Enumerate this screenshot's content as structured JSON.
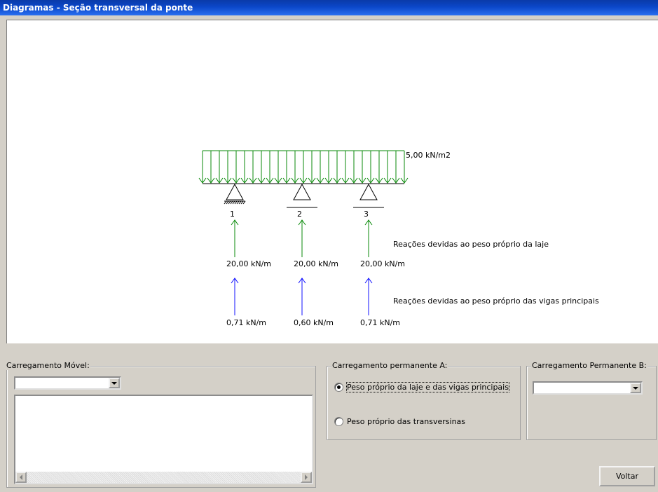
{
  "window": {
    "title": "Diagramas - Seção transversal da ponte"
  },
  "diagram": {
    "load_label": "5,00 kN/m2",
    "supports": [
      "1",
      "2",
      "3"
    ],
    "slab_reactions_caption": "Reações devidas ao peso próprio da laje",
    "slab_reactions": [
      "20,00 kN/m",
      "20,00 kN/m",
      "20,00 kN/m"
    ],
    "beam_reactions_caption": "Reações devidas ao peso próprio das vigas principais",
    "beam_reactions": [
      "0,71 kN/m",
      "0,60 kN/m",
      "0,71 kN/m"
    ],
    "colors": {
      "load": "#0a8a0a",
      "slab_arrow": "#0a8a0a",
      "beam_arrow": "#1010ff"
    }
  },
  "movel": {
    "label": "Carregamento Móvel:",
    "selected": ""
  },
  "permA": {
    "label": "Carregamento permanente A:",
    "options": [
      "Peso próprio da laje e das vigas principais",
      "Peso próprio das transversinas"
    ],
    "selected_index": 0
  },
  "permB": {
    "label": "Carregamento Permanente B:",
    "selected": ""
  },
  "buttons": {
    "back": "Voltar"
  }
}
